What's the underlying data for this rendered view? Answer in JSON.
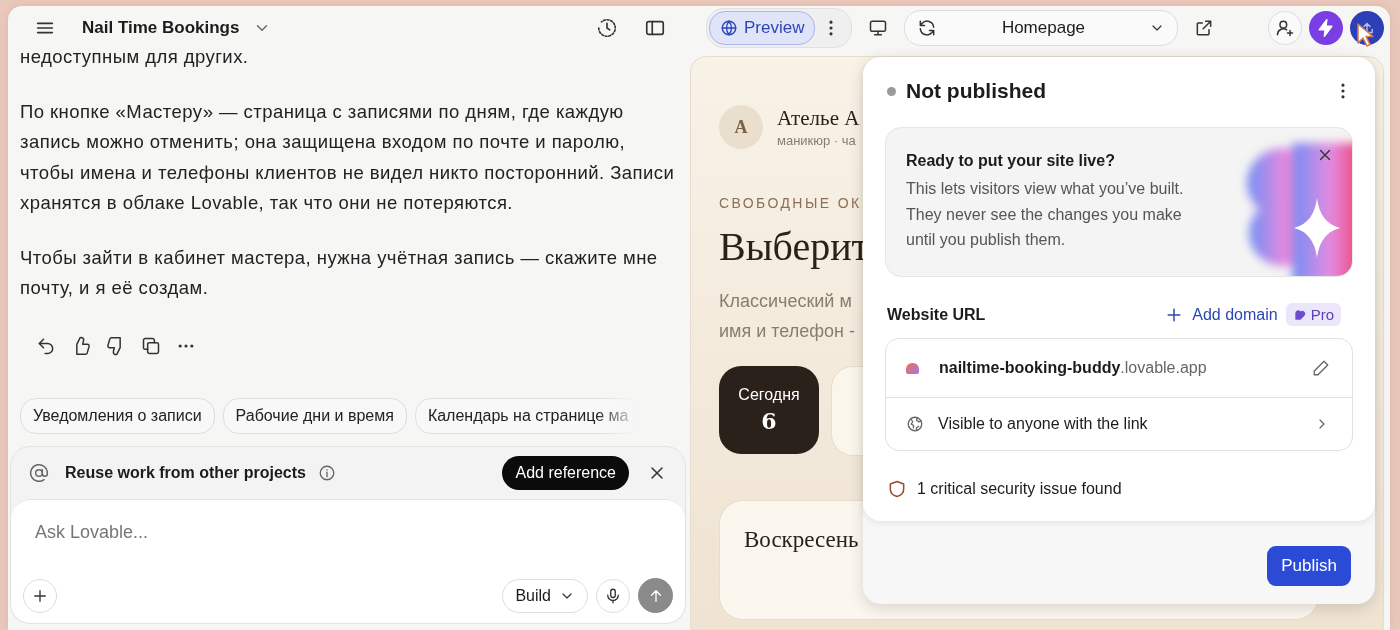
{
  "header": {
    "project_title": "Nail Time Bookings"
  },
  "chat": {
    "paragraphs": [
      "недоступным для других.",
      "По кнопке «Мастеру» — страница с записями по дням, где каждую запись можно отменить; она защищена входом по почте и паролю, чтобы имена и телефоны клиентов не видел никто посторонний. Записи хранятся в облаке Lovable, так что они не потеряются.",
      "Чтобы зайти в кабинет мастера, нужна учётная запись — скажите мне почту, и я её создам."
    ],
    "suggestions": [
      "Уведомления о записи",
      "Рабочие дни и время",
      "Календарь на странице ма"
    ],
    "reference_bar": {
      "label": "Reuse work from other projects",
      "button": "Add reference"
    },
    "composer": {
      "placeholder": "Ask Lovable...",
      "mode": "Build"
    }
  },
  "preview_toolbar": {
    "tabs": [
      {
        "label": "Preview",
        "selected": true
      }
    ],
    "page_select": "Homepage"
  },
  "preview": {
    "avatar_letter": "А",
    "studio_name": "Ателье А",
    "studio_meta": "маникюр · ча",
    "eyebrow": "СВОБОДНЫЕ ОК",
    "heading": "Выберит",
    "lines": [
      "Классический м",
      "имя и телефон -"
    ],
    "day_label": "Сегодня",
    "day_number": "6",
    "day_card": "Воскресень"
  },
  "publish_panel": {
    "status": "Not published",
    "published": false,
    "promo": {
      "title": "Ready to put your site live?",
      "body": "This lets visitors view what you’ve built. They never see the changes you make until you publish them."
    },
    "url_label": "Website URL",
    "add_domain": "Add domain",
    "badge": "Pro",
    "url": {
      "subdomain": "nailtime-booking-buddy",
      "domain": ".lovable.app"
    },
    "visibility": "Visible to anyone with the link",
    "security": "1 critical security issue found",
    "publish_button": "Publish"
  }
}
